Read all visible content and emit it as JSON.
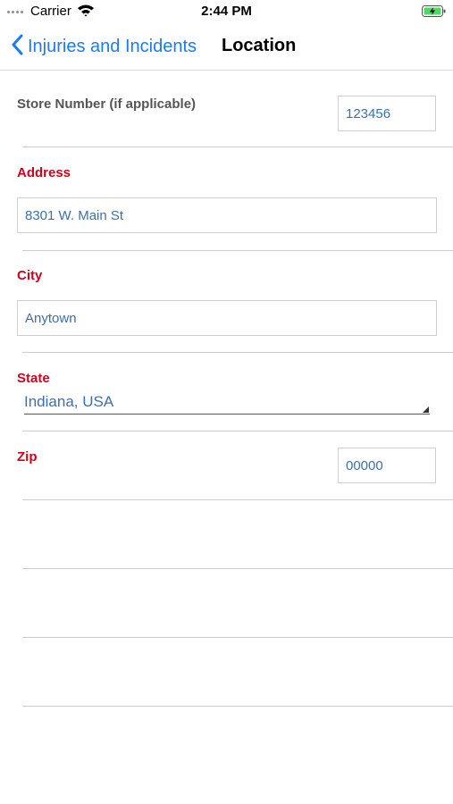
{
  "status_bar": {
    "carrier": "Carrier",
    "time": "2:44 PM",
    "icons": [
      "signal-dots-icon",
      "wifi-icon",
      "battery-charging-icon"
    ]
  },
  "nav": {
    "back_label": "Injuries and Incidents",
    "title": "Location",
    "accent_color": "#1a7bf4"
  },
  "form": {
    "store_number": {
      "label": "Store Number (if applicable)",
      "value": "123456"
    },
    "address": {
      "label": "Address",
      "value": "8301 W. Main St"
    },
    "city": {
      "label": "City",
      "value": "Anytown"
    },
    "state": {
      "label": "State",
      "value": "Indiana, USA"
    },
    "zip": {
      "label": "Zip",
      "value": "00000"
    },
    "required_label_color": "#d0021b"
  }
}
